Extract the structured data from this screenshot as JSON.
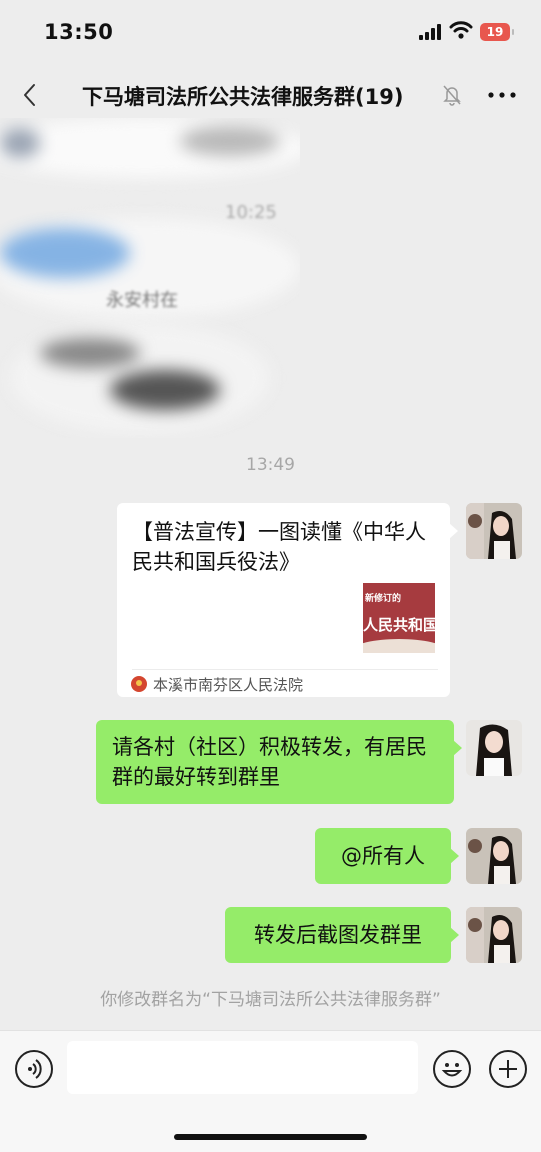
{
  "status_bar": {
    "time": "13:50",
    "battery": "19"
  },
  "nav": {
    "title": "下马塘司法所公共法律服务群(19)"
  },
  "blurred": {
    "time": "10:25",
    "snippet": "永安村在"
  },
  "timestamp": "13:49",
  "share_card": {
    "title": "【普法宣传】一图读懂《中华人民共和国兵役法》",
    "thumb_top": "新修订的",
    "thumb_main": "人民共和国兵",
    "source": "本溪市南芬区人民法院"
  },
  "messages": [
    {
      "text": "请各村（社区）积极转发，有居民群的最好转到群里"
    },
    {
      "text": "@所有人"
    },
    {
      "text": "转发后截图发群里"
    }
  ],
  "system_note": "你修改群名为“下马塘司法所公共法律服务群”",
  "colors": {
    "bubble": "#95ec69",
    "background": "#ededed",
    "battery": "#e8574e"
  }
}
